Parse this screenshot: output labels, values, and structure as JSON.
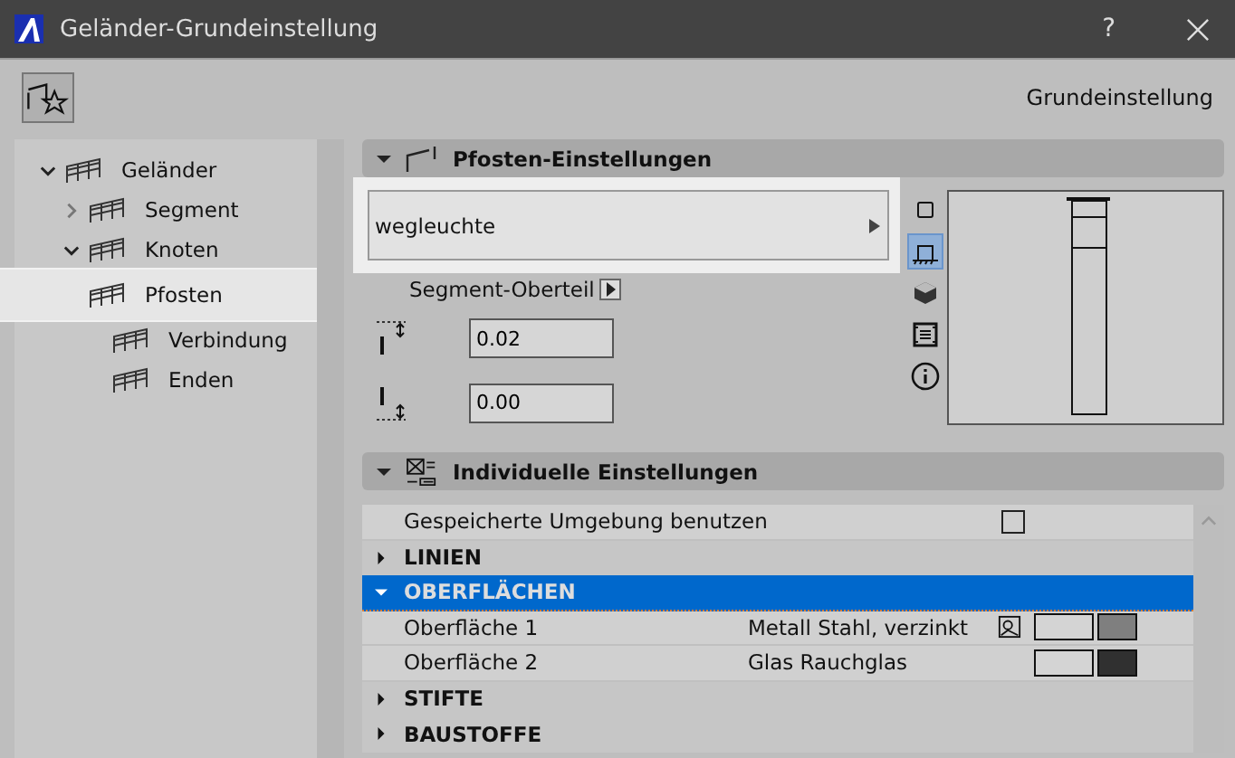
{
  "window": {
    "title": "Geländer-Grundeinstellung",
    "help": "?"
  },
  "toolbar": {
    "label": "Grundeinstellung"
  },
  "tree": [
    {
      "label": "Geländer",
      "expanded": true,
      "selected": false,
      "children": [
        {
          "label": "Segment",
          "expanded": false,
          "selected": false
        },
        {
          "label": "Knoten",
          "expanded": true,
          "selected": false,
          "children": [
            {
              "label": "Pfosten",
              "selected": true
            },
            {
              "label": "Verbindung",
              "selected": false
            },
            {
              "label": "Enden",
              "selected": false
            }
          ]
        }
      ]
    }
  ],
  "post_panel": {
    "title": "Pfosten-Einstellungen",
    "expanded": true,
    "dropdown": "wegleuchte",
    "link": "Segment-Oberteil",
    "fields": [
      "0.02",
      "0.00"
    ],
    "views": [
      {
        "kind": "plan",
        "selected": false
      },
      {
        "kind": "side",
        "selected": true
      },
      {
        "kind": "cube",
        "selected": false
      },
      {
        "kind": "list",
        "selected": false
      },
      {
        "kind": "info",
        "selected": false
      }
    ]
  },
  "custom_panel": {
    "title": "Individuelle Einstellungen",
    "expanded": true,
    "rows": [
      {
        "kind": "checkbox",
        "label": "Gespeicherte Umgebung benutzen",
        "checked": false
      },
      {
        "kind": "group",
        "label": "LINIEN",
        "expanded": false,
        "selected": false
      },
      {
        "kind": "group",
        "label": "OBERFLÄCHEN",
        "expanded": true,
        "selected": true
      },
      {
        "kind": "surface",
        "label": "Oberfläche 1",
        "value": "Metall Stahl, verzinkt",
        "overridden": true,
        "color": "#7f7f7f"
      },
      {
        "kind": "surface",
        "label": "Oberfläche 2",
        "value": "Glas Rauchglas",
        "overridden": false,
        "color": "#303030"
      },
      {
        "kind": "group",
        "label": "STIFTE",
        "expanded": false,
        "selected": false
      },
      {
        "kind": "group",
        "label": "BAUSTOFFE",
        "expanded": false,
        "selected": false
      }
    ]
  }
}
